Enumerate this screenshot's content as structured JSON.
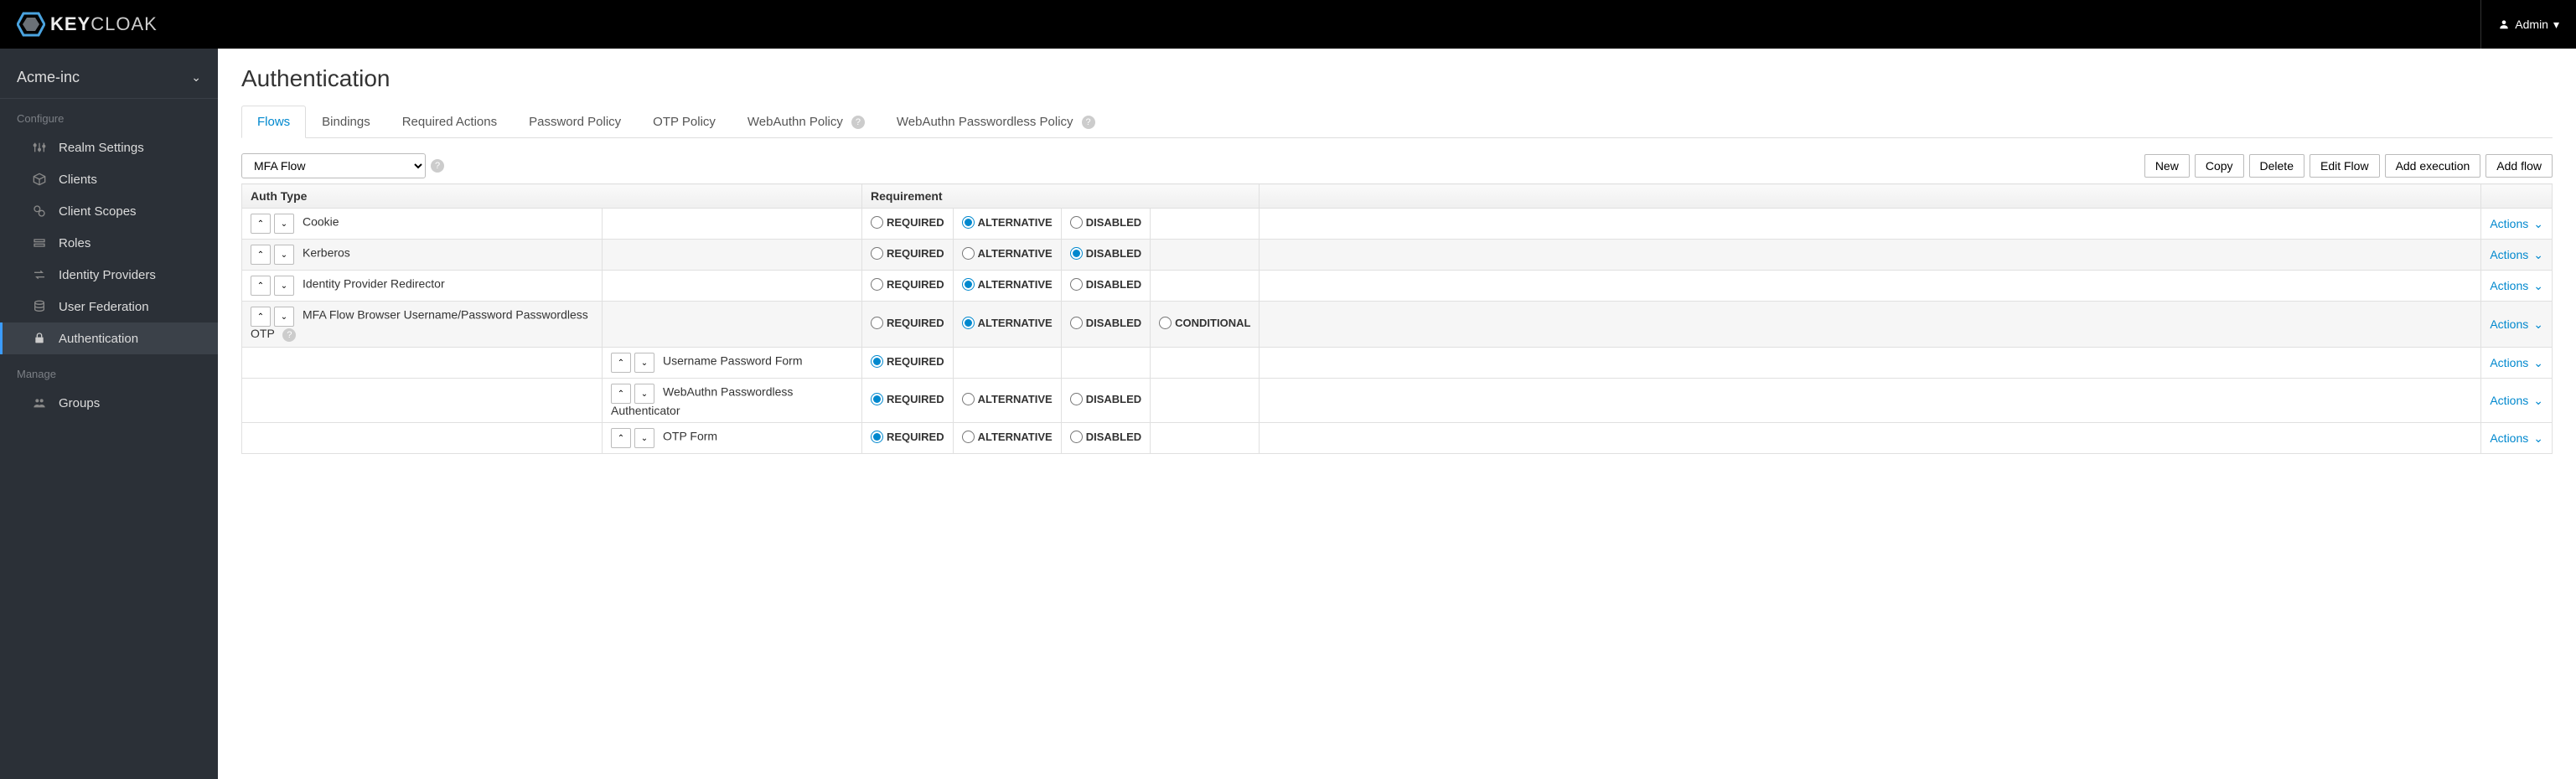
{
  "header": {
    "brand_prefix": "KEY",
    "brand_suffix": "CLOAK",
    "user_label": "Admin"
  },
  "sidebar": {
    "realm": "Acme-inc",
    "sections": {
      "configure": "Configure",
      "manage": "Manage"
    },
    "items": {
      "realm_settings": "Realm Settings",
      "clients": "Clients",
      "client_scopes": "Client Scopes",
      "roles": "Roles",
      "identity_providers": "Identity Providers",
      "user_federation": "User Federation",
      "authentication": "Authentication",
      "groups": "Groups"
    }
  },
  "page": {
    "title": "Authentication",
    "tabs": {
      "flows": "Flows",
      "bindings": "Bindings",
      "required_actions": "Required Actions",
      "password_policy": "Password Policy",
      "otp_policy": "OTP Policy",
      "webauthn_policy": "WebAuthn Policy",
      "webauthn_passwordless": "WebAuthn Passwordless Policy"
    },
    "flow_selected": "MFA Flow",
    "buttons": {
      "new": "New",
      "copy": "Copy",
      "delete": "Delete",
      "edit_flow": "Edit Flow",
      "add_execution": "Add execution",
      "add_flow": "Add flow"
    },
    "table": {
      "col_auth_type": "Auth Type",
      "col_requirement": "Requirement",
      "actions_label": "Actions",
      "req_labels": {
        "required": "REQUIRED",
        "alternative": "ALTERNATIVE",
        "disabled": "DISABLED",
        "conditional": "CONDITIONAL"
      },
      "rows": [
        {
          "name": "Cookie",
          "level": 0,
          "options": [
            "required",
            "alternative",
            "disabled"
          ],
          "selected": "alternative"
        },
        {
          "name": "Kerberos",
          "level": 0,
          "options": [
            "required",
            "alternative",
            "disabled"
          ],
          "selected": "disabled"
        },
        {
          "name": "Identity Provider Redirector",
          "level": 0,
          "options": [
            "required",
            "alternative",
            "disabled"
          ],
          "selected": "alternative"
        },
        {
          "name": "MFA Flow Browser Username/Password Passwordless OTP",
          "level": 0,
          "help": true,
          "options": [
            "required",
            "alternative",
            "disabled",
            "conditional"
          ],
          "selected": "alternative"
        },
        {
          "name": "Username Password Form",
          "level": 1,
          "options": [
            "required"
          ],
          "selected": "required"
        },
        {
          "name": "WebAuthn Passwordless Authenticator",
          "level": 1,
          "options": [
            "required",
            "alternative",
            "disabled"
          ],
          "selected": "required"
        },
        {
          "name": "OTP Form",
          "level": 1,
          "options": [
            "required",
            "alternative",
            "disabled"
          ],
          "selected": "required"
        }
      ]
    }
  }
}
